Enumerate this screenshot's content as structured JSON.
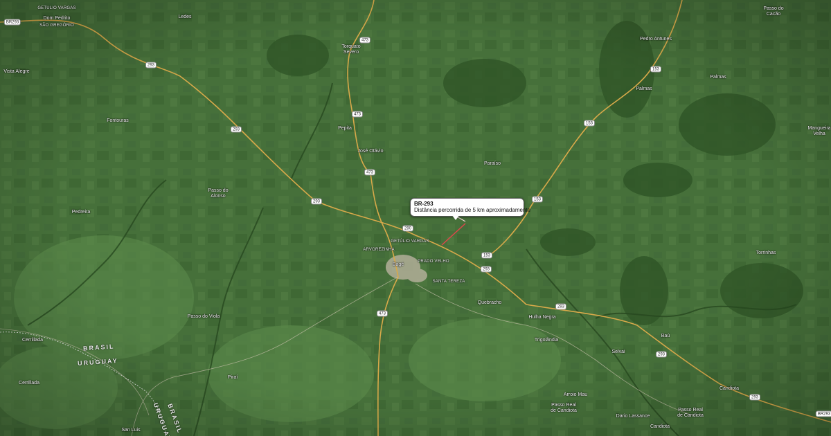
{
  "callout": {
    "road": "BR-293",
    "description": "Distância percorrida de 5 km aproximadamente"
  },
  "country_labels": {
    "north": "BRASIL",
    "south": "URUGUAY",
    "east_a": "BRASIL",
    "east_b": "URUGUAY"
  },
  "places": [
    {
      "id": "getulio-vargas-nw",
      "text": "GETULIO VARGAS",
      "small": true
    },
    {
      "id": "dom-pedrito",
      "text": "Dom Pedrito"
    },
    {
      "id": "sao-gregorio",
      "text": "SÃO GREGÓRIO",
      "small": true
    },
    {
      "id": "ledes",
      "text": "Ledes"
    },
    {
      "id": "torquato-severo",
      "text": "Torquato\nSevero"
    },
    {
      "id": "vista-alegre",
      "text": "Vista Alegre"
    },
    {
      "id": "pedro-antunes",
      "text": "Pedro Antunes"
    },
    {
      "id": "passo-do-cacao",
      "text": "Passo do\nCacão"
    },
    {
      "id": "palmas-1",
      "text": "Palmas"
    },
    {
      "id": "palmas-2",
      "text": "Palmas"
    },
    {
      "id": "fontouras",
      "text": "Fontouras"
    },
    {
      "id": "pepita",
      "text": "Pepita"
    },
    {
      "id": "jose-otavio",
      "text": "José Otávio"
    },
    {
      "id": "mangueira-velha",
      "text": "Mangueira\nVelha"
    },
    {
      "id": "paraiso",
      "text": "Paraíso"
    },
    {
      "id": "passo-do-alonso",
      "text": "Passo do\nAlonso"
    },
    {
      "id": "pedreira",
      "text": "Pedreira"
    },
    {
      "id": "getulio-vargas",
      "text": "GETÚLIO VARGAS",
      "small": true
    },
    {
      "id": "arvorezinha",
      "text": "ARVOREZINHA",
      "small": true
    },
    {
      "id": "bage",
      "text": "Bagé"
    },
    {
      "id": "prado-velho",
      "text": "PRADO VELHO",
      "small": true
    },
    {
      "id": "santa-tereza",
      "text": "SANTA TEREZA",
      "small": true
    },
    {
      "id": "torrinhas",
      "text": "Torrinhas"
    },
    {
      "id": "quebracho",
      "text": "Quebracho"
    },
    {
      "id": "hulha-negra",
      "text": "Hulha Negra"
    },
    {
      "id": "passo-do-viola",
      "text": "Passo do Viola"
    },
    {
      "id": "trigolandia",
      "text": "Trigolândia"
    },
    {
      "id": "bau",
      "text": "Baú"
    },
    {
      "id": "cerrilada-1",
      "text": "Cerrillada"
    },
    {
      "id": "selvai",
      "text": "Selvai"
    },
    {
      "id": "cerrilada-2",
      "text": "Cerrillada"
    },
    {
      "id": "pirai",
      "text": "Piraí"
    },
    {
      "id": "arroio-mau",
      "text": "Arroio Mau"
    },
    {
      "id": "candiota",
      "text": "Candiota"
    },
    {
      "id": "passo-real-de-candiota-1",
      "text": "Passo Real\nde Candiota"
    },
    {
      "id": "dario-lassance",
      "text": "Dario Lassance"
    },
    {
      "id": "passo-real-de-candiota-2",
      "text": "Passo Real\nde Candiota"
    },
    {
      "id": "candiota-2",
      "text": "Candiota"
    },
    {
      "id": "sao-luis",
      "text": "San Luis"
    }
  ],
  "road_shields": [
    {
      "id": "r-br293-nw",
      "text": "BR293"
    },
    {
      "id": "r-473-n",
      "text": "473"
    },
    {
      "id": "r-293-a",
      "text": "293"
    },
    {
      "id": "r-153-ne",
      "text": "153"
    },
    {
      "id": "r-473-b",
      "text": "473"
    },
    {
      "id": "r-293-b",
      "text": "293"
    },
    {
      "id": "r-153-b",
      "text": "153"
    },
    {
      "id": "r-473-c",
      "text": "473"
    },
    {
      "id": "r-293-c",
      "text": "293"
    },
    {
      "id": "r-153-c",
      "text": "153"
    },
    {
      "id": "r-290-bage",
      "text": "290"
    },
    {
      "id": "r-153-d",
      "text": "153"
    },
    {
      "id": "r-293-d",
      "text": "293"
    },
    {
      "id": "r-473-d",
      "text": "473"
    },
    {
      "id": "r-293-e",
      "text": "293"
    },
    {
      "id": "r-293-f",
      "text": "293"
    },
    {
      "id": "r-293-g",
      "text": "293"
    },
    {
      "id": "r-br293-se",
      "text": "BR293"
    }
  ]
}
